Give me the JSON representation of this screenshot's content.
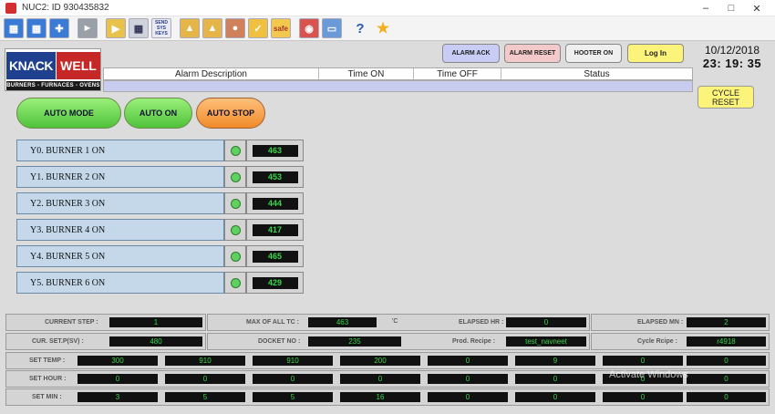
{
  "window": {
    "title": "NUC2: ID 930435832"
  },
  "toolbar": {
    "icons": [
      "network-monitor-icon",
      "network-sync-icon",
      "tools-icon",
      "speaker-icon",
      "folder-export-icon",
      "grid-keys-icon",
      "send-sys-keys-icon",
      "lock-icon",
      "lock-user-icon",
      "user-icon",
      "snapshot-icon",
      "safe-icon",
      "camera-icon",
      "monitor-icon",
      "help-icon",
      "star-icon"
    ],
    "send_keys_label": "SEND SYS KEYS",
    "safe_label": "safe",
    "help_label": "?"
  },
  "logo": {
    "left": "KNACK",
    "right": "WELL",
    "tagline": "BURNERS - FURNACES - OVENS"
  },
  "header_buttons": {
    "alarm_ack": "ALARM ACK",
    "alarm_reset": "ALARM RESET",
    "hooter_on": "HOOTER ON",
    "log_in": "Log In"
  },
  "datetime": {
    "date": "10/12/2018",
    "time": "23: 19: 35"
  },
  "alarm_table": {
    "columns": [
      "Alarm Description",
      "Time ON",
      "Time OFF",
      "Status"
    ]
  },
  "cycle_reset": {
    "line1": "CYCLE",
    "line2": "RESET"
  },
  "mode_buttons": {
    "auto_mode": "AUTO MODE",
    "auto_on": "AUTO ON",
    "auto_stop": "AUTO STOP"
  },
  "burners": [
    {
      "label": "Y0. BURNER 1 ON",
      "value": "463"
    },
    {
      "label": "Y1. BURNER 2 ON",
      "value": "453"
    },
    {
      "label": "Y2. BURNER 3 ON",
      "value": "444"
    },
    {
      "label": "Y3. BURNER 4 ON",
      "value": "417"
    },
    {
      "label": "Y4. BURNER 5 ON",
      "value": "465"
    },
    {
      "label": "Y5. BURNER 6 ON",
      "value": "429"
    }
  ],
  "status": {
    "current_step_label": "CURRENT STEP :",
    "current_step": "1",
    "max_tc_label": "MAX OF ALL TC :",
    "max_tc": "463",
    "max_tc_unit": "'C",
    "elapsed_hr_label": "ELAPSED HR :",
    "elapsed_hr": "0",
    "elapsed_mn_label": "ELAPSED MN :",
    "elapsed_mn": "2",
    "cur_set_label": "CUR. SET.P(SV) :",
    "cur_set": "480",
    "docket_label": "DOCKET NO :",
    "docket": "235",
    "prod_recipe_label": "Prod. Recipe :",
    "prod_recipe": "test_navneet",
    "cycle_recipe_label": "Cycle Rcipe :",
    "cycle_recipe": "r4918"
  },
  "grid": {
    "set_temp_label": "SET TEMP :",
    "set_temp": [
      "300",
      "910",
      "910",
      "200",
      "0",
      "9",
      "0",
      "0"
    ],
    "set_hour_label": "SET HOUR :",
    "set_hour": [
      "0",
      "0",
      "0",
      "0",
      "0",
      "0",
      "0",
      "0"
    ],
    "set_min_label": "SET MIN :",
    "set_min": [
      "3",
      "5",
      "5",
      "16",
      "0",
      "0",
      "0",
      "0"
    ]
  },
  "watermark": "Activate Windows"
}
